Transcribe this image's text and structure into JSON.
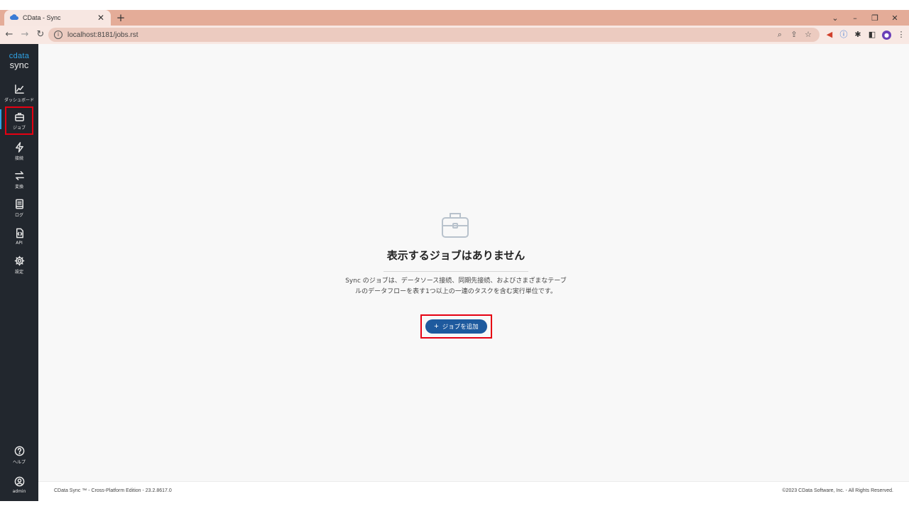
{
  "browser": {
    "tab_title": "CData - Sync",
    "tab_close": "✕",
    "new_tab": "+",
    "url": "localhost:8181/jobs.rst",
    "win_controls": [
      "⌄",
      "–",
      "❐",
      "✕"
    ]
  },
  "sidebar": {
    "logo_top": "cdata",
    "logo_bottom": "sync",
    "items": [
      {
        "label": "ダッシュボード",
        "icon": "chart-line-icon"
      },
      {
        "label": "ジョブ",
        "icon": "briefcase-icon"
      },
      {
        "label": "接続",
        "icon": "bolt-icon"
      },
      {
        "label": "変換",
        "icon": "arrows-swap-icon"
      },
      {
        "label": "ログ",
        "icon": "log-book-icon"
      },
      {
        "label": "API",
        "icon": "api-file-icon"
      },
      {
        "label": "設定",
        "icon": "gear-icon"
      }
    ],
    "bottom_items": [
      {
        "label": "ヘルプ",
        "icon": "help-icon"
      },
      {
        "label": "admin",
        "icon": "user-icon"
      }
    ]
  },
  "main": {
    "empty_title": "表示するジョブはありません",
    "empty_description": "Sync のジョブは、データソース接続、同期先接続、およびさまざまなテーブルのデータフローを表す1つ以上の一連のタスクを含む実行単位です。",
    "add_button_label": "ジョブを追加",
    "add_button_icon": "plus-icon"
  },
  "footer": {
    "left": "CData Sync ™ - Cross-Platform Edition - 23.2.8617.0",
    "right": "©2023 CData Software, Inc. - All Rights Reserved."
  },
  "colors": {
    "sidebar_bg": "#22272e",
    "accent": "#1e5a9e",
    "highlight": "#e60012",
    "tabbar": "#e4ac98"
  }
}
